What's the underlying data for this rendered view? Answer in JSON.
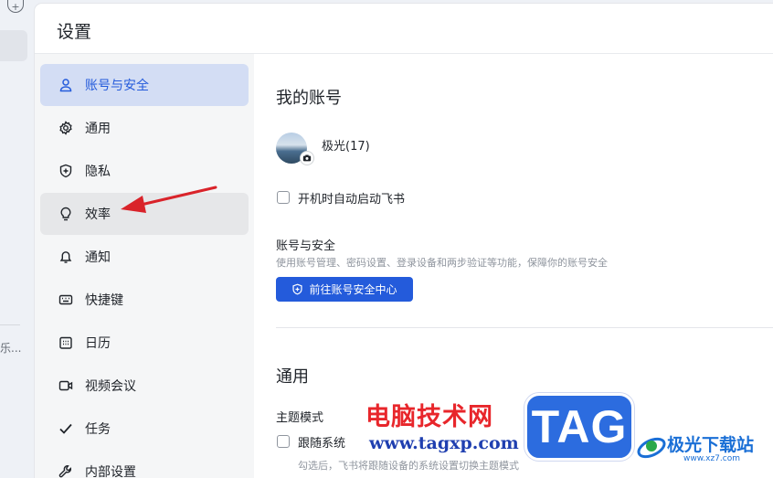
{
  "background": {
    "partial_text": "乐..."
  },
  "window": {
    "title": "设置"
  },
  "sidebar": {
    "items": [
      {
        "label": "账号与安全",
        "icon": "user-icon"
      },
      {
        "label": "通用",
        "icon": "gear-icon"
      },
      {
        "label": "隐私",
        "icon": "shield-icon"
      },
      {
        "label": "效率",
        "icon": "lightbulb-icon"
      },
      {
        "label": "通知",
        "icon": "bell-icon"
      },
      {
        "label": "快捷键",
        "icon": "keyboard-icon"
      },
      {
        "label": "日历",
        "icon": "calendar-icon"
      },
      {
        "label": "视频会议",
        "icon": "video-icon"
      },
      {
        "label": "任务",
        "icon": "check-icon"
      },
      {
        "label": "内部设置",
        "icon": "wrench-icon"
      }
    ]
  },
  "account": {
    "section_title": "我的账号",
    "user_name": "极光(17)",
    "autostart_label": "开机时自动启动飞书",
    "security_title": "账号与安全",
    "security_desc": "使用账号管理、密码设置、登录设备和两步验证等功能，保障你的账号安全",
    "security_button": "前往账号安全中心"
  },
  "general": {
    "section_title": "通用",
    "theme_label": "主题模式",
    "follow_system_label": "跟随系统",
    "follow_system_hint": "勾选后，飞书将跟随设备的系统设置切换主题模式"
  },
  "watermark": {
    "site_name": "电脑技术网",
    "site_url": "www.tagxp.com",
    "tag_text": "TAG",
    "logo_name": "极光下载站",
    "logo_url": "www.xz7.com"
  },
  "colors": {
    "accent": "#245bdb",
    "active_bg": "#d3ddf4",
    "annotation_arrow": "#d9232a"
  }
}
